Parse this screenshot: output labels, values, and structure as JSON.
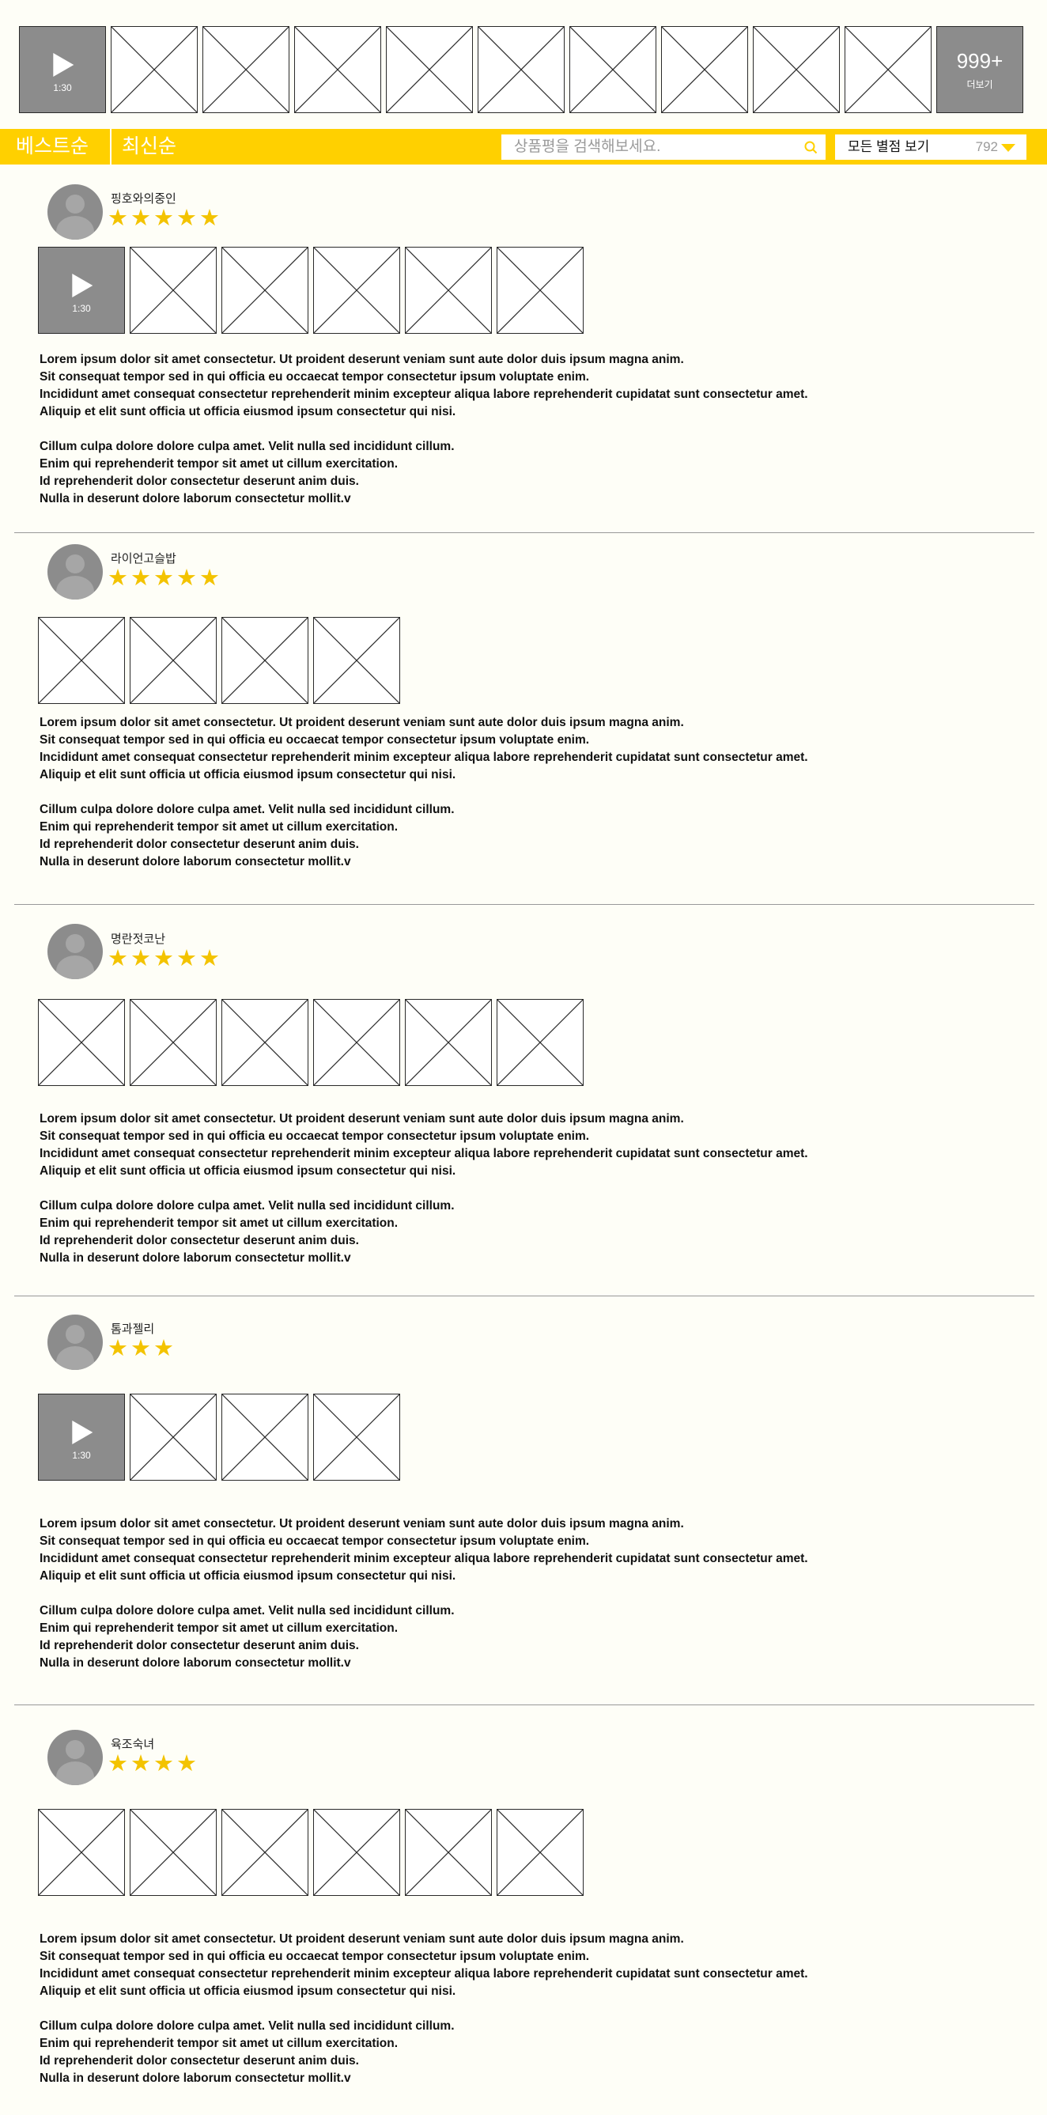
{
  "gallery": {
    "items": [
      {
        "kind": "video",
        "duration": "1:30"
      },
      {
        "kind": "image"
      },
      {
        "kind": "image"
      },
      {
        "kind": "image"
      },
      {
        "kind": "image"
      },
      {
        "kind": "image"
      },
      {
        "kind": "image"
      },
      {
        "kind": "image"
      },
      {
        "kind": "image"
      },
      {
        "kind": "image"
      },
      {
        "kind": "more",
        "count": "999+",
        "label": "더보기"
      }
    ]
  },
  "toolbar": {
    "sort_best": "베스트순",
    "sort_newest": "최신순",
    "search_placeholder": "상품평을 검색해보세요.",
    "filter_label": "모든 별점 보기",
    "filter_count": "792"
  },
  "colors": {
    "accent": "#ffd000",
    "star": "#f3c300",
    "placeholder_gray": "#8c8c8c"
  },
  "review_text": {
    "p1": "Lorem ipsum dolor sit amet consectetur. Ut proident deserunt veniam sunt aute dolor duis ipsum magna anim.\nSit consequat tempor sed in qui officia eu occaecat tempor consectetur ipsum voluptate enim.\nIncididunt amet consequat consectetur reprehenderit minim excepteur aliqua labore reprehenderit cupidatat sunt consectetur amet.\nAliquip et elit sunt officia ut officia eiusmod ipsum consectetur qui nisi.",
    "p2": "Cillum culpa dolore dolore culpa amet. Velit nulla sed incididunt cillum.\nEnim qui reprehenderit tempor sit amet ut cillum exercitation.\nId reprehenderit dolor consectetur deserunt anim duis.\nNulla in deserunt dolore laborum consectetur mollit.v"
  },
  "reviews": [
    {
      "username": "핑호와의중인",
      "rating": 5,
      "photos": [
        {
          "kind": "video",
          "duration": "1:30"
        },
        {
          "kind": "image"
        },
        {
          "kind": "image"
        },
        {
          "kind": "image"
        },
        {
          "kind": "image"
        },
        {
          "kind": "image"
        }
      ]
    },
    {
      "username": "라이언고슬밥",
      "rating": 5,
      "photos": [
        {
          "kind": "image"
        },
        {
          "kind": "image"
        },
        {
          "kind": "image"
        },
        {
          "kind": "image"
        }
      ]
    },
    {
      "username": "명란젓코난",
      "rating": 5,
      "photos": [
        {
          "kind": "image"
        },
        {
          "kind": "image"
        },
        {
          "kind": "image"
        },
        {
          "kind": "image"
        },
        {
          "kind": "image"
        },
        {
          "kind": "image"
        }
      ]
    },
    {
      "username": "톰과젤리",
      "rating": 3,
      "photos": [
        {
          "kind": "video",
          "duration": "1:30"
        },
        {
          "kind": "image"
        },
        {
          "kind": "image"
        },
        {
          "kind": "image"
        }
      ]
    },
    {
      "username": "육조숙녀",
      "rating": 4,
      "photos": [
        {
          "kind": "image"
        },
        {
          "kind": "image"
        },
        {
          "kind": "image"
        },
        {
          "kind": "image"
        },
        {
          "kind": "image"
        },
        {
          "kind": "image"
        }
      ]
    }
  ]
}
